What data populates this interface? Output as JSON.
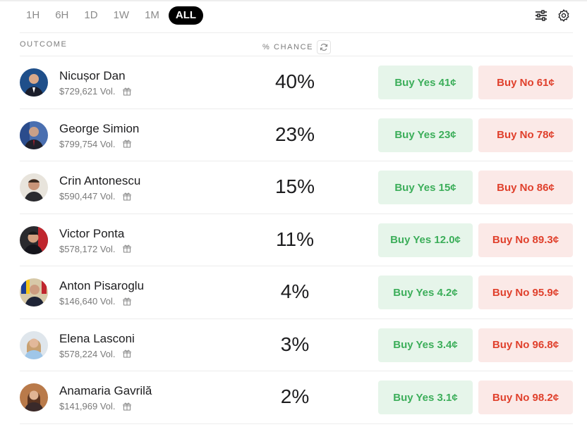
{
  "time_ranges": [
    "1H",
    "6H",
    "1D",
    "1W",
    "1M",
    "ALL"
  ],
  "active_range": "ALL",
  "columns": {
    "outcome": "OUTCOME",
    "chance": "% CHANCE"
  },
  "icons": {
    "filters": "sliders-icon",
    "settings": "gear-icon",
    "refresh": "refresh-icon",
    "gift": "gift-icon"
  },
  "colors": {
    "yes_bg": "#e6f5ea",
    "yes_text": "#3cae5a",
    "no_bg": "#fbe9e7",
    "no_text": "#e0402c",
    "active_tab": "#000000"
  },
  "outcomes": [
    {
      "name": "Nicușor Dan",
      "volume": "$729,621 Vol.",
      "chance": "40%",
      "buy_yes": "Buy Yes 41¢",
      "buy_no": "Buy No 61¢"
    },
    {
      "name": "George Simion",
      "volume": "$799,754 Vol.",
      "chance": "23%",
      "buy_yes": "Buy Yes 23¢",
      "buy_no": "Buy No 78¢"
    },
    {
      "name": "Crin Antonescu",
      "volume": "$590,447 Vol.",
      "chance": "15%",
      "buy_yes": "Buy Yes 15¢",
      "buy_no": "Buy No 86¢"
    },
    {
      "name": "Victor Ponta",
      "volume": "$578,172 Vol.",
      "chance": "11%",
      "buy_yes": "Buy Yes 12.0¢",
      "buy_no": "Buy No 89.3¢"
    },
    {
      "name": "Anton Pisaroglu",
      "volume": "$146,640 Vol.",
      "chance": "4%",
      "buy_yes": "Buy Yes 4.2¢",
      "buy_no": "Buy No 95.9¢"
    },
    {
      "name": "Elena Lasconi",
      "volume": "$578,224 Vol.",
      "chance": "3%",
      "buy_yes": "Buy Yes 3.4¢",
      "buy_no": "Buy No 96.8¢"
    },
    {
      "name": "Anamaria Gavrilă",
      "volume": "$141,969 Vol.",
      "chance": "2%",
      "buy_yes": "Buy Yes 3.1¢",
      "buy_no": "Buy No 98.2¢"
    }
  ]
}
